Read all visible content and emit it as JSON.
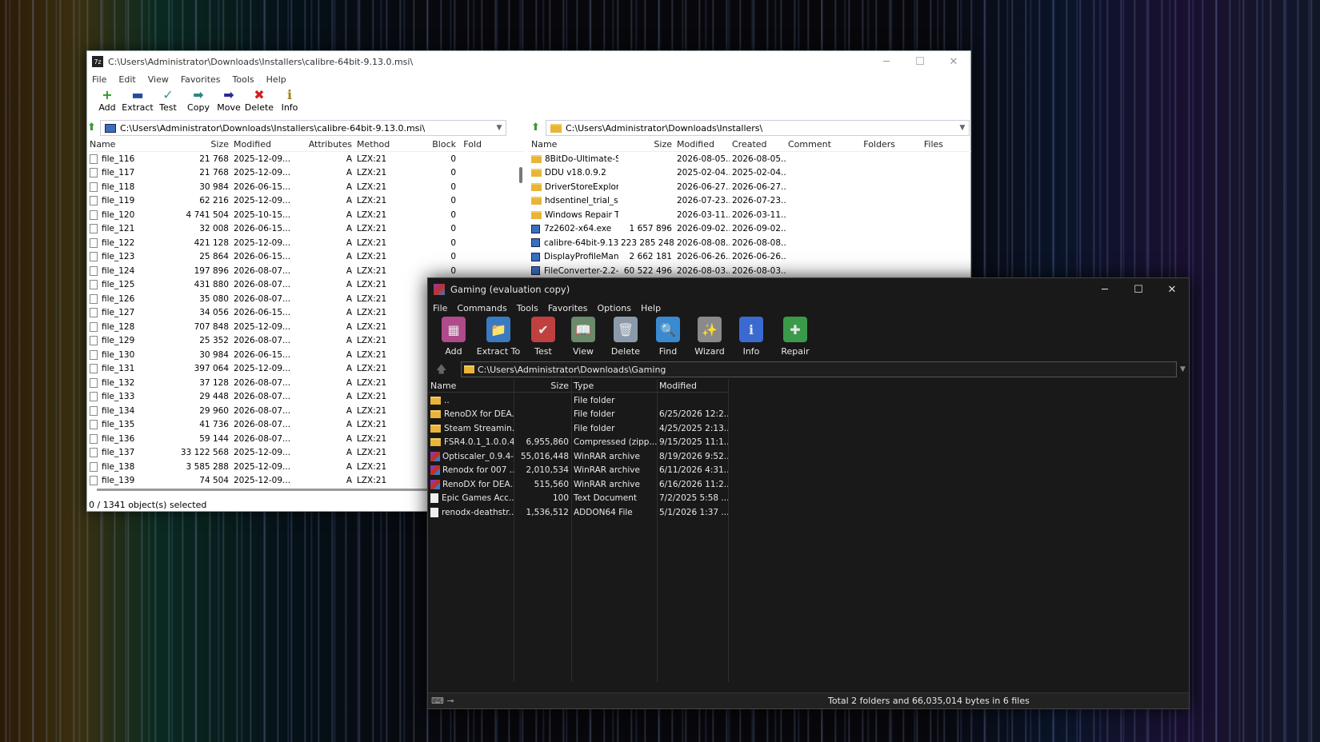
{
  "sevenzip": {
    "title": "C:\\Users\\Administrator\\Downloads\\Installers\\calibre-64bit-9.13.0.msi\\",
    "app_icon_text": "7z",
    "menu": [
      "File",
      "Edit",
      "View",
      "Favorites",
      "Tools",
      "Help"
    ],
    "toolbar": [
      {
        "label": "Add",
        "icon": "+",
        "color": "#2a9a2a"
      },
      {
        "label": "Extract",
        "icon": "▬",
        "color": "#2a4aa0"
      },
      {
        "label": "Test",
        "icon": "✓",
        "color": "#2a9aa0"
      },
      {
        "label": "Copy",
        "icon": "➡",
        "color": "#2a8a80"
      },
      {
        "label": "Move",
        "icon": "➡",
        "color": "#2a2a90"
      },
      {
        "label": "Delete",
        "icon": "✖",
        "color": "#d02020"
      },
      {
        "label": "Info",
        "icon": "ℹ",
        "color": "#a08020"
      }
    ],
    "left_path": "C:\\Users\\Administrator\\Downloads\\Installers\\calibre-64bit-9.13.0.msi\\",
    "right_path": "C:\\Users\\Administrator\\Downloads\\Installers\\",
    "left_columns": [
      "Name",
      "Size",
      "Modified",
      "Attributes",
      "Method",
      "Block",
      "Fold"
    ],
    "left_rows": [
      [
        "file_116",
        "21 768",
        "2025-12-09...",
        "A",
        "LZX:21",
        "0"
      ],
      [
        "file_117",
        "21 768",
        "2025-12-09...",
        "A",
        "LZX:21",
        "0"
      ],
      [
        "file_118",
        "30 984",
        "2026-06-15...",
        "A",
        "LZX:21",
        "0"
      ],
      [
        "file_119",
        "62 216",
        "2025-12-09...",
        "A",
        "LZX:21",
        "0"
      ],
      [
        "file_120",
        "4 741 504",
        "2025-10-15...",
        "A",
        "LZX:21",
        "0"
      ],
      [
        "file_121",
        "32 008",
        "2026-06-15...",
        "A",
        "LZX:21",
        "0"
      ],
      [
        "file_122",
        "421 128",
        "2025-12-09...",
        "A",
        "LZX:21",
        "0"
      ],
      [
        "file_123",
        "25 864",
        "2026-06-15...",
        "A",
        "LZX:21",
        "0"
      ],
      [
        "file_124",
        "197 896",
        "2026-08-07...",
        "A",
        "LZX:21",
        "0"
      ],
      [
        "file_125",
        "431 880",
        "2026-08-07...",
        "A",
        "LZX:21",
        "0"
      ],
      [
        "file_126",
        "35 080",
        "2026-08-07...",
        "A",
        "LZX:21",
        "0"
      ],
      [
        "file_127",
        "34 056",
        "2026-06-15...",
        "A",
        "LZX:21",
        "0"
      ],
      [
        "file_128",
        "707 848",
        "2025-12-09...",
        "A",
        "LZX:21",
        "0"
      ],
      [
        "file_129",
        "25 352",
        "2026-08-07...",
        "A",
        "LZX:21",
        "0"
      ],
      [
        "file_130",
        "30 984",
        "2026-06-15...",
        "A",
        "LZX:21",
        "0"
      ],
      [
        "file_131",
        "397 064",
        "2025-12-09...",
        "A",
        "LZX:21",
        "0"
      ],
      [
        "file_132",
        "37 128",
        "2026-08-07...",
        "A",
        "LZX:21",
        "0"
      ],
      [
        "file_133",
        "29 448",
        "2026-08-07...",
        "A",
        "LZX:21",
        "0"
      ],
      [
        "file_134",
        "29 960",
        "2026-08-07...",
        "A",
        "LZX:21",
        "0"
      ],
      [
        "file_135",
        "41 736",
        "2026-08-07...",
        "A",
        "LZX:21",
        "0"
      ],
      [
        "file_136",
        "59 144",
        "2026-08-07...",
        "A",
        "LZX:21",
        "0"
      ],
      [
        "file_137",
        "33 122 568",
        "2025-12-09...",
        "A",
        "LZX:21",
        "0"
      ],
      [
        "file_138",
        "3 585 288",
        "2025-12-09...",
        "A",
        "LZX:21",
        "0"
      ],
      [
        "file_139",
        "74 504",
        "2025-12-09...",
        "A",
        "LZX:21",
        "0"
      ]
    ],
    "right_columns": [
      "Name",
      "Size",
      "Modified",
      "Created",
      "Comment",
      "Folders",
      "Files"
    ],
    "right_rows": [
      {
        "icon": "folder",
        "cells": [
          "8BitDo-Ultimate-S...",
          "",
          "2026-08-05...",
          "2026-08-05..."
        ]
      },
      {
        "icon": "folder",
        "cells": [
          "DDU v18.0.9.2",
          "",
          "2025-02-04...",
          "2025-02-04..."
        ]
      },
      {
        "icon": "folder",
        "cells": [
          "DriverStoreExplor...",
          "",
          "2026-06-27...",
          "2026-06-27..."
        ]
      },
      {
        "icon": "folder",
        "cells": [
          "hdsentinel_trial_se...",
          "",
          "2026-07-23...",
          "2026-07-23..."
        ]
      },
      {
        "icon": "folder",
        "cells": [
          "Windows Repair T...",
          "",
          "2026-03-11...",
          "2026-03-11..."
        ]
      },
      {
        "icon": "exe",
        "cells": [
          "7z2602-x64.exe",
          "1 657 896",
          "2026-09-02...",
          "2026-09-02..."
        ]
      },
      {
        "icon": "exe",
        "cells": [
          "calibre-64bit-9.13....",
          "223 285 248",
          "2026-08-08...",
          "2026-08-08..."
        ]
      },
      {
        "icon": "exe",
        "cells": [
          "DisplayProfileMan...",
          "2 662 181",
          "2026-06-26...",
          "2026-06-26..."
        ]
      },
      {
        "icon": "exe",
        "cells": [
          "FileConverter-2.2-...",
          "60 522 496",
          "2026-08-03...",
          "2026-08-03..."
        ]
      }
    ],
    "status": "0 / 1341 object(s) selected"
  },
  "winrar": {
    "title": "Gaming (evaluation copy)",
    "menu": [
      "File",
      "Commands",
      "Tools",
      "Favorites",
      "Options",
      "Help"
    ],
    "toolbar": [
      {
        "label": "Add",
        "icon": "▦",
        "color": "#b04a8a"
      },
      {
        "label": "Extract To",
        "icon": "📁",
        "color": "#3a7ac0"
      },
      {
        "label": "Test",
        "icon": "✔",
        "color": "#c04040"
      },
      {
        "label": "View",
        "icon": "📖",
        "color": "#6a8a6a"
      },
      {
        "label": "Delete",
        "icon": "🗑",
        "color": "#8a9aaa"
      },
      {
        "label": "Find",
        "icon": "🔍",
        "color": "#3a8ad0"
      },
      {
        "label": "Wizard",
        "icon": "✨",
        "color": "#8a8a8a"
      },
      {
        "label": "Info",
        "icon": "ℹ",
        "color": "#3a6ad0"
      },
      {
        "label": "Repair",
        "icon": "✚",
        "color": "#3a9a4a"
      }
    ],
    "path": "C:\\Users\\Administrator\\Downloads\\Gaming",
    "columns": [
      "Name",
      "Size",
      "Type",
      "Modified"
    ],
    "rows": [
      {
        "icon": "folder",
        "name": "..",
        "size": "",
        "type": "File folder",
        "modified": ""
      },
      {
        "icon": "folder",
        "name": "RenoDX for DEA...",
        "size": "",
        "type": "File folder",
        "modified": "6/25/2026 12:2..."
      },
      {
        "icon": "folder",
        "name": "Steam Streamin...",
        "size": "",
        "type": "File folder",
        "modified": "4/25/2025 2:13..."
      },
      {
        "icon": "folder",
        "name": "FSR4.0.1_1.0.0.40...",
        "size": "6,955,860",
        "type": "Compressed (zipp...",
        "modified": "9/15/2025 11:1..."
      },
      {
        "icon": "rar",
        "name": "Optiscaler_0.9.4-...",
        "size": "55,016,448",
        "type": "WinRAR archive",
        "modified": "8/19/2026 9:52..."
      },
      {
        "icon": "rar",
        "name": "Renodx for 007 ...",
        "size": "2,010,534",
        "type": "WinRAR archive",
        "modified": "6/11/2026 4:31..."
      },
      {
        "icon": "rar",
        "name": "RenoDX for DEA...",
        "size": "515,560",
        "type": "WinRAR archive",
        "modified": "6/16/2026 11:2..."
      },
      {
        "icon": "txt",
        "name": "Epic Games Acc...",
        "size": "100",
        "type": "Text Document",
        "modified": "7/2/2025 5:58 ..."
      },
      {
        "icon": "txt",
        "name": "renodx-deathstr...",
        "size": "1,536,512",
        "type": "ADDON64 File",
        "modified": "5/1/2026 1:37 ..."
      }
    ],
    "status": "Total 2 folders and 66,035,014 bytes in 6 files"
  }
}
